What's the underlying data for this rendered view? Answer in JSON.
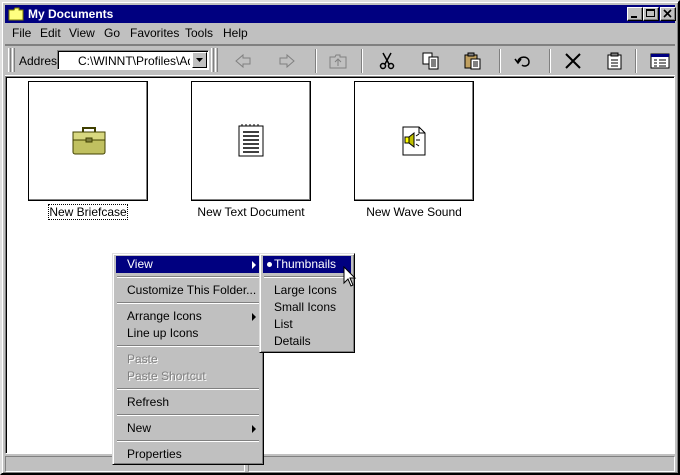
{
  "window": {
    "title": "My Documents"
  },
  "menubar": [
    "File",
    "Edit",
    "View",
    "Go",
    "Favorites",
    "Tools",
    "Help"
  ],
  "address": {
    "label": "Addres",
    "value": "C:\\WINNT\\Profiles\\Ad"
  },
  "toolbar_icons": [
    "back-icon",
    "forward-icon",
    "up-folder-icon",
    "cut-icon",
    "copy-icon",
    "paste-icon",
    "undo-icon",
    "delete-icon",
    "properties-icon",
    "views-icon"
  ],
  "items": [
    {
      "label": "New Briefcase",
      "icon": "briefcase-icon",
      "selected": true
    },
    {
      "label": "New Text Document",
      "icon": "text-document-icon",
      "selected": false
    },
    {
      "label": "New Wave Sound",
      "icon": "wave-sound-icon",
      "selected": false
    }
  ],
  "context_menu": {
    "view": "View",
    "customize": "Customize This Folder...",
    "arrange": "Arrange Icons",
    "lineup": "Line up Icons",
    "paste": "Paste",
    "paste_shortcut": "Paste Shortcut",
    "refresh": "Refresh",
    "new": "New",
    "properties": "Properties"
  },
  "view_submenu": {
    "thumbnails": "Thumbnails",
    "large_icons": "Large Icons",
    "small_icons": "Small Icons",
    "list": "List",
    "details": "Details"
  },
  "colors": {
    "highlight": "#000080",
    "face": "#c0c0c0",
    "titlebar": "#000080"
  }
}
